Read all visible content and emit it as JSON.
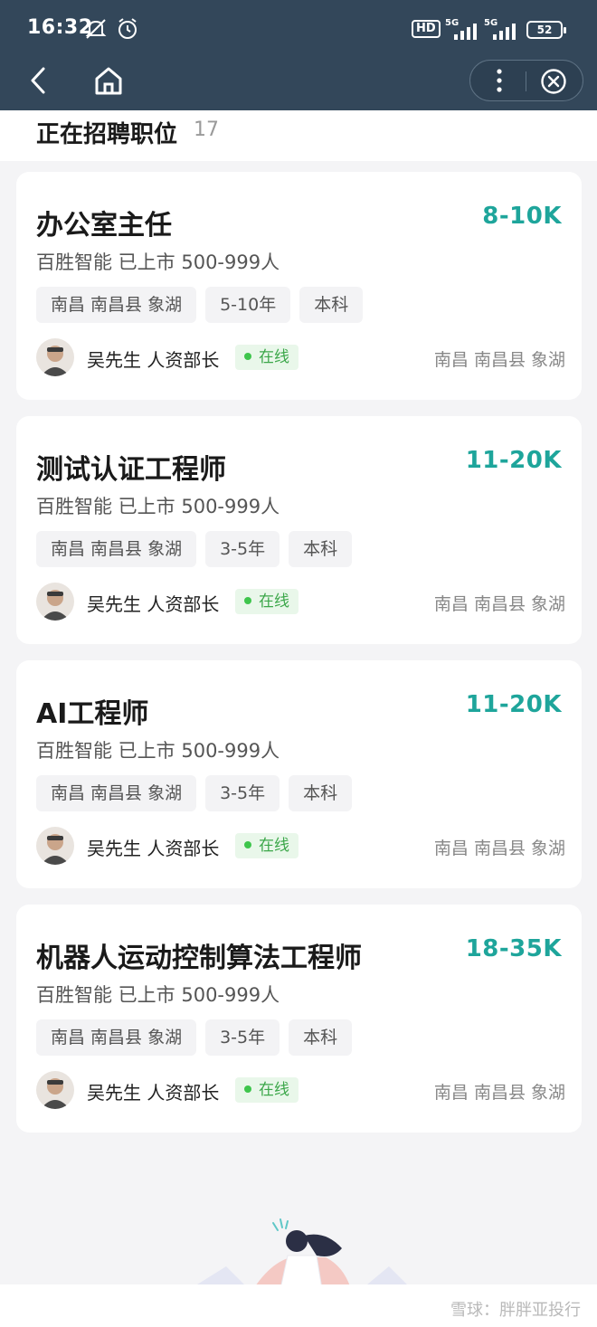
{
  "status_bar": {
    "time": "16:32",
    "hd_label": "HD",
    "signal_1": "5G",
    "signal_2": "5G",
    "battery": "52"
  },
  "section": {
    "title": "正在招聘职位",
    "count": "17"
  },
  "jobs": [
    {
      "title": "办公室主任",
      "salary": "8-10K",
      "company": "百胜智能  已上市  500-999人",
      "tags": [
        "南昌 南昌县 象湖",
        "5-10年",
        "本科"
      ],
      "recruiter": "吴先生 人资部长",
      "status": "在线",
      "location": "南昌 南昌县 象湖"
    },
    {
      "title": "测试认证工程师",
      "salary": "11-20K",
      "company": "百胜智能  已上市  500-999人",
      "tags": [
        "南昌 南昌县 象湖",
        "3-5年",
        "本科"
      ],
      "recruiter": "吴先生 人资部长",
      "status": "在线",
      "location": "南昌 南昌县 象湖"
    },
    {
      "title": "AI工程师",
      "salary": "11-20K",
      "company": "百胜智能  已上市  500-999人",
      "tags": [
        "南昌 南昌县 象湖",
        "3-5年",
        "本科"
      ],
      "recruiter": "吴先生 人资部长",
      "status": "在线",
      "location": "南昌 南昌县 象湖"
    },
    {
      "title": "机器人运动控制算法工程师",
      "salary": "18-35K",
      "company": "百胜智能  已上市  500-999人",
      "tags": [
        "南昌 南昌县 象湖",
        "3-5年",
        "本科"
      ],
      "recruiter": "吴先生 人资部长",
      "status": "在线",
      "location": "南昌 南昌县 象湖"
    }
  ],
  "watermark": "雪球：胖胖亚投行",
  "colors": {
    "topbar": "#33475a",
    "salary": "#1ea59b",
    "online": "#3ca74a"
  },
  "icons": [
    "back-arrow-icon",
    "home-icon",
    "more-dots-icon",
    "close-circle-icon",
    "mute-bell-icon",
    "alarm-icon"
  ]
}
